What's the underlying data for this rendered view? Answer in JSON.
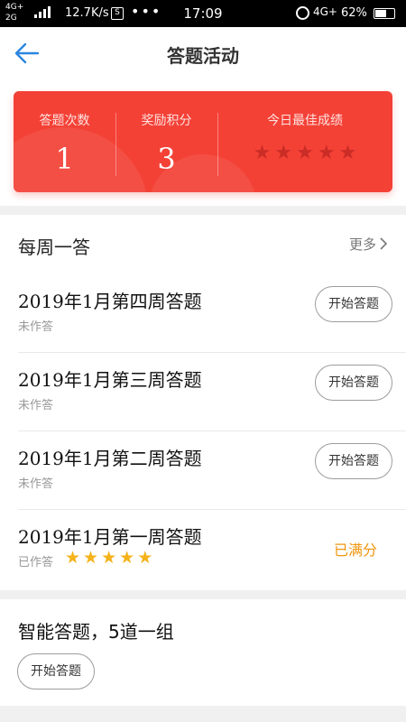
{
  "status_bar": {
    "network_left": "4G+",
    "network_left2": "2G",
    "speed": "12.7K/s",
    "notification_badge": "S",
    "dots": "•••",
    "time": "17:09",
    "network_right": "4G+",
    "battery_pct": "62%",
    "battery_level": 0.62
  },
  "nav": {
    "title": "答题活动",
    "back_icon": "arrow-left-icon"
  },
  "stats": {
    "answer_count_label": "答题次数",
    "answer_count": "1",
    "points_label": "奖励积分",
    "points": "3",
    "best_label": "今日最佳成绩",
    "best_stars": 0,
    "best_stars_max": 5
  },
  "weekly": {
    "title": "每周一答",
    "more": "更多",
    "items": [
      {
        "title": "2019年1月第四周答题",
        "status": "未作答",
        "action": "开始答题",
        "stars": 0
      },
      {
        "title": "2019年1月第三周答题",
        "status": "未作答",
        "action": "开始答题",
        "stars": 0
      },
      {
        "title": "2019年1月第二周答题",
        "status": "未作答",
        "action": "开始答题",
        "stars": 0
      },
      {
        "title": "2019年1月第一周答题",
        "status": "已作答",
        "result": "已满分",
        "stars": 5
      }
    ]
  },
  "smart": {
    "title": "智能答题，5道一组",
    "action": "开始答题"
  },
  "colors": {
    "accent_blue": "#2b86e0",
    "card_red": "#f44136",
    "star_gold": "#f6b21a",
    "score_orange": "#f0960e"
  }
}
